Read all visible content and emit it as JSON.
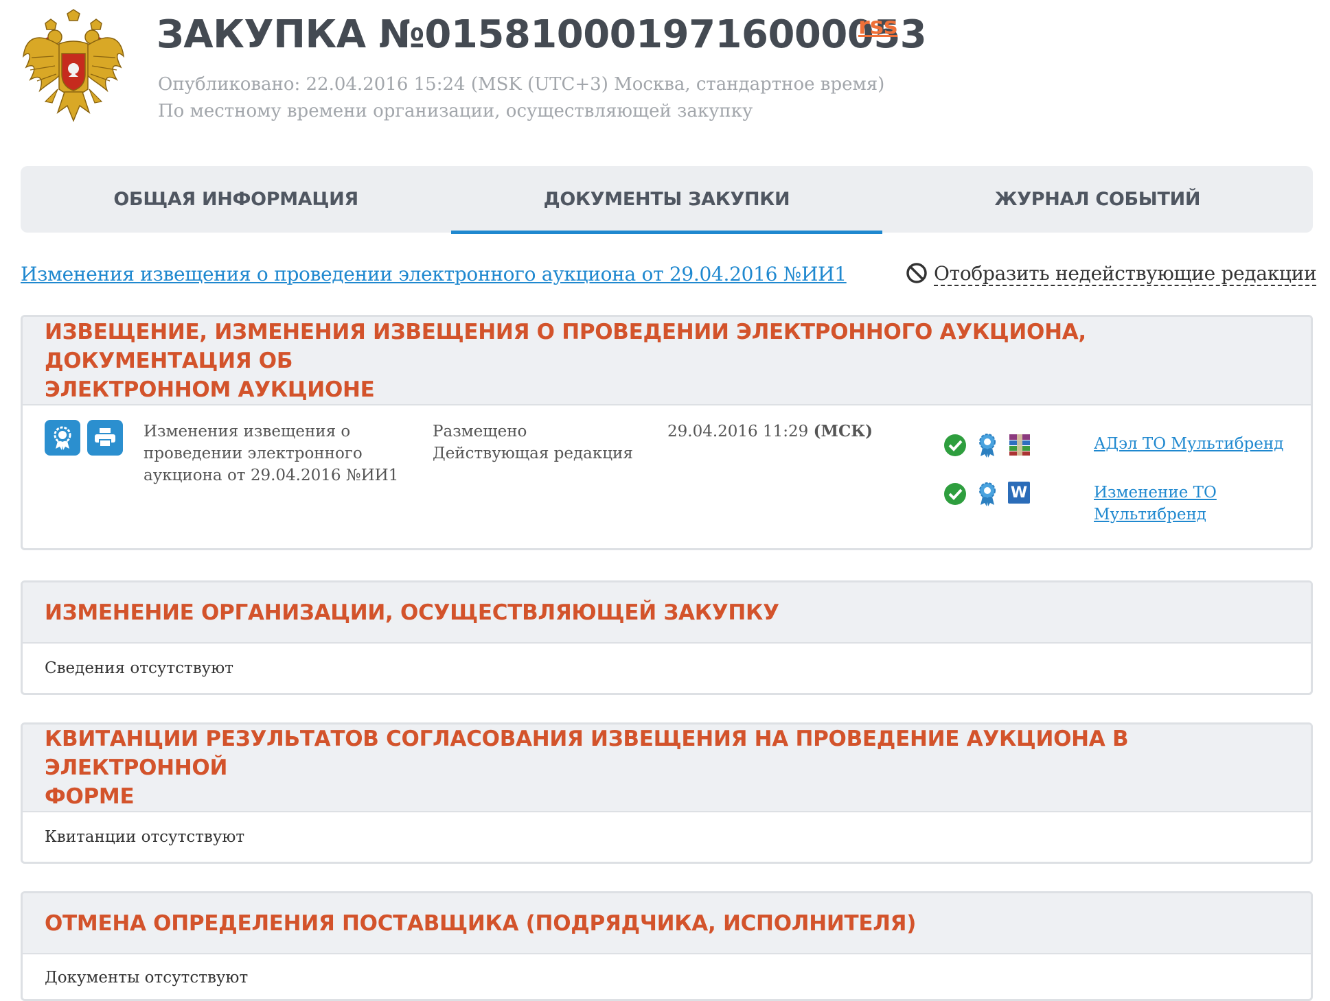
{
  "header": {
    "title": "ЗАКУПКА №0158100019716000053",
    "rss": "rss",
    "published": "Опубликовано: 22.04.2016 15:24 (MSK (UTC+3) Москва, стандартное время)",
    "local_time_note": "По местному времени организации, осуществляющей закупку"
  },
  "tabs": [
    {
      "label": "ОБЩАЯ ИНФОРМАЦИЯ",
      "active": false
    },
    {
      "label": "ДОКУМЕНТЫ ЗАКУПКИ",
      "active": true
    },
    {
      "label": "ЖУРНАЛ СОБЫТИЙ",
      "active": false
    }
  ],
  "notice_link": "Изменения извещения о проведении электронного аукциона от 29.04.2016 №ИИ1",
  "toggle_inactive": "Отобразить недействующие редакции",
  "panels": {
    "notice": {
      "title_line1": "ИЗВЕЩЕНИЕ, ИЗМЕНЕНИЯ ИЗВЕЩЕНИЯ О ПРОВЕДЕНИИ ЭЛЕКТРОННОГО АУКЦИОНА, ДОКУМЕНТАЦИЯ ОБ",
      "title_line2": "ЭЛЕКТРОННОМ АУКЦИОНЕ",
      "doc": {
        "name_lines": [
          "Изменения извещения о",
          "проведении электронного",
          "аукциона от 29.04.2016 №ИИ1"
        ],
        "status_lines": [
          "Размещено",
          "Действующая редакция"
        ],
        "date": "29.04.2016 11:29",
        "tz": "(МСК)",
        "files": [
          {
            "name_lines": [
              "АДэл ТО Мультибренд"
            ],
            "type_icon": "archive-icon"
          },
          {
            "name_lines": [
              "Изменение ТО",
              "Мультибренд"
            ],
            "type_icon": "word-icon",
            "type_letter": "W"
          }
        ]
      }
    },
    "org_change": {
      "title": "ИЗМЕНЕНИЕ ОРГАНИЗАЦИИ, ОСУЩЕСТВЛЯЮЩЕЙ ЗАКУПКУ",
      "body": "Сведения отсутствуют"
    },
    "receipts": {
      "title_line1": "КВИТАНЦИИ РЕЗУЛЬТАТОВ СОГЛАСОВАНИЯ ИЗВЕЩЕНИЯ НА ПРОВЕДЕНИЕ АУКЦИОНА В ЭЛЕКТРОННОЙ",
      "title_line2": "ФОРМЕ",
      "body": "Квитанции отсутствуют"
    },
    "cancel": {
      "title": "ОТМЕНА ОПРЕДЕЛЕНИЯ ПОСТАВЩИКА (ПОДРЯДЧИКА, ИСПОЛНИТЕЛЯ)",
      "body": "Документы отсутствуют"
    }
  },
  "colors": {
    "accent_blue": "#1f88cf",
    "section_title": "#d3532b",
    "rss": "#f07038",
    "ok_green": "#2e9e3e"
  }
}
